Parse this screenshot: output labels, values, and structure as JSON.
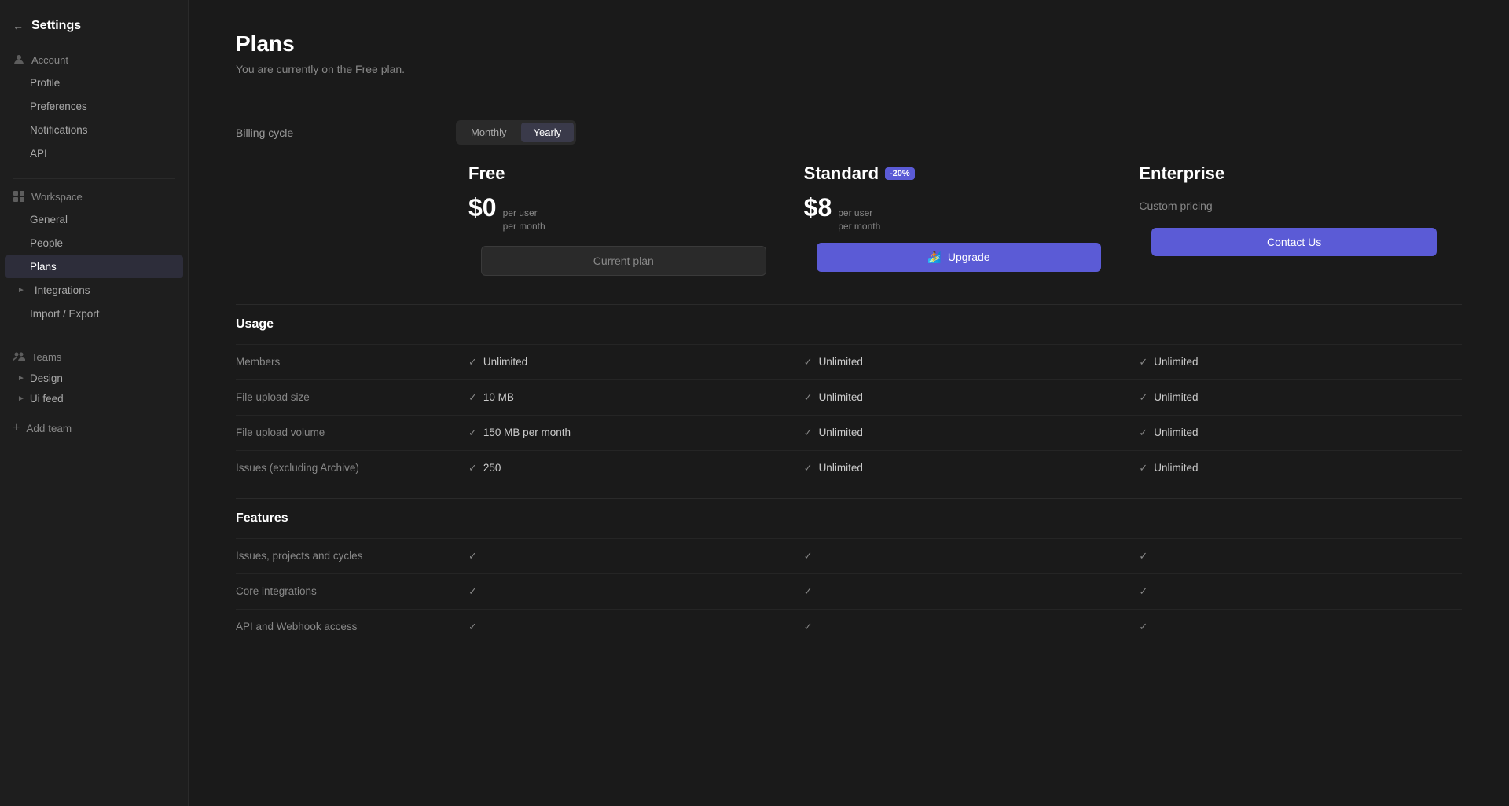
{
  "sidebar": {
    "back_icon": "←",
    "title": "Settings",
    "account_section": {
      "label": "Account",
      "items": [
        {
          "id": "profile",
          "label": "Profile",
          "active": false
        },
        {
          "id": "preferences",
          "label": "Preferences",
          "active": false
        },
        {
          "id": "notifications",
          "label": "Notifications",
          "active": false
        },
        {
          "id": "api",
          "label": "API",
          "active": false
        }
      ]
    },
    "workspace_section": {
      "label": "Workspace",
      "items": [
        {
          "id": "general",
          "label": "General",
          "active": false
        },
        {
          "id": "people",
          "label": "People",
          "active": false
        },
        {
          "id": "plans",
          "label": "Plans",
          "active": true
        },
        {
          "id": "integrations",
          "label": "Integrations",
          "active": false,
          "has_arrow": true
        },
        {
          "id": "import-export",
          "label": "Import / Export",
          "active": false
        }
      ]
    },
    "teams_section": {
      "label": "Teams",
      "items": [
        {
          "id": "design",
          "label": "Design",
          "has_arrow": true
        },
        {
          "id": "ui-feed",
          "label": "Ui feed",
          "has_arrow": true
        }
      ]
    },
    "add_team_label": "Add team"
  },
  "page": {
    "title": "Plans",
    "subtitle": "You are currently on the Free plan."
  },
  "billing": {
    "label": "Billing cycle",
    "options": [
      {
        "id": "monthly",
        "label": "Monthly",
        "active": false
      },
      {
        "id": "yearly",
        "label": "Yearly",
        "active": true
      }
    ]
  },
  "plans": [
    {
      "id": "free",
      "name": "Free",
      "discount_badge": null,
      "price": "$0",
      "price_desc_line1": "per user",
      "price_desc_line2": "per month",
      "custom_pricing": null,
      "button_label": "Current plan",
      "button_type": "current",
      "button_icon": null
    },
    {
      "id": "standard",
      "name": "Standard",
      "discount_badge": "-20%",
      "price": "$8",
      "price_desc_line1": "per user",
      "price_desc_line2": "per month",
      "custom_pricing": null,
      "button_label": "Upgrade",
      "button_type": "upgrade",
      "button_icon": "🏄"
    },
    {
      "id": "enterprise",
      "name": "Enterprise",
      "discount_badge": null,
      "price": null,
      "price_desc_line1": null,
      "price_desc_line2": null,
      "custom_pricing": "Custom pricing",
      "button_label": "Contact Us",
      "button_type": "contact",
      "button_icon": null
    }
  ],
  "usage_section": {
    "label": "Usage",
    "features": [
      {
        "name": "Members",
        "values": [
          "Unlimited",
          "Unlimited",
          "Unlimited"
        ],
        "types": [
          "text",
          "text",
          "text"
        ]
      },
      {
        "name": "File upload size",
        "values": [
          "10 MB",
          "Unlimited",
          "Unlimited"
        ],
        "types": [
          "text",
          "text",
          "text"
        ]
      },
      {
        "name": "File upload volume",
        "values": [
          "150 MB per month",
          "Unlimited",
          "Unlimited"
        ],
        "types": [
          "text",
          "text",
          "text"
        ]
      },
      {
        "name": "Issues (excluding Archive)",
        "values": [
          "250",
          "Unlimited",
          "Unlimited"
        ],
        "types": [
          "text",
          "text",
          "text"
        ]
      }
    ]
  },
  "features_section": {
    "label": "Features",
    "features": [
      {
        "name": "Issues, projects and cycles",
        "values": [
          true,
          true,
          true
        ]
      },
      {
        "name": "Core integrations",
        "values": [
          true,
          true,
          true
        ]
      },
      {
        "name": "API and Webhook access",
        "values": [
          true,
          true,
          true
        ]
      }
    ]
  }
}
